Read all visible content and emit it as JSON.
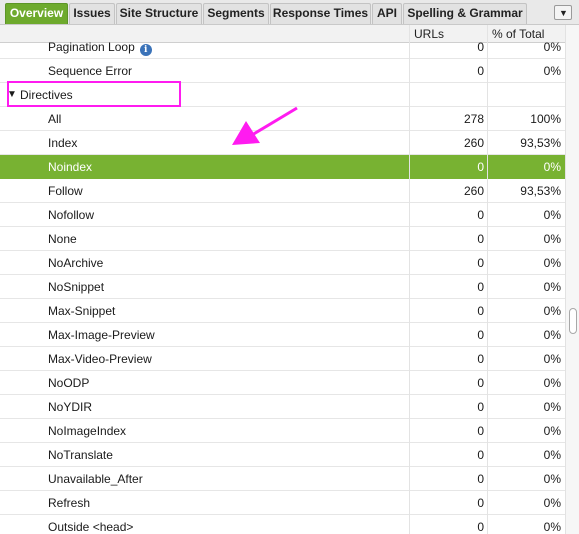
{
  "tabs": [
    {
      "label": "Overview",
      "active": true
    },
    {
      "label": "Issues",
      "active": false
    },
    {
      "label": "Site Structure",
      "active": false
    },
    {
      "label": "Segments",
      "active": false
    },
    {
      "label": "Response Times",
      "active": false
    },
    {
      "label": "API",
      "active": false
    },
    {
      "label": "Spelling & Grammar",
      "active": false
    }
  ],
  "tab_menu_icon": "chevron-down-icon",
  "columns": {
    "urls": "URLs",
    "pct": "% of Total"
  },
  "rows": [
    {
      "name": "Pagination Loop",
      "urls": "0",
      "pct": "0%",
      "info": "i"
    },
    {
      "name": "Sequence Error",
      "urls": "0",
      "pct": "0%"
    },
    {
      "name": "Directives",
      "urls": "",
      "pct": "",
      "group": true,
      "expanded_icon": "▼"
    },
    {
      "name": "All",
      "urls": "278",
      "pct": "100%"
    },
    {
      "name": "Index",
      "urls": "260",
      "pct": "93,53%"
    },
    {
      "name": "Noindex",
      "urls": "0",
      "pct": "0%",
      "selected": true
    },
    {
      "name": "Follow",
      "urls": "260",
      "pct": "93,53%"
    },
    {
      "name": "Nofollow",
      "urls": "0",
      "pct": "0%"
    },
    {
      "name": "None",
      "urls": "0",
      "pct": "0%"
    },
    {
      "name": "NoArchive",
      "urls": "0",
      "pct": "0%"
    },
    {
      "name": "NoSnippet",
      "urls": "0",
      "pct": "0%"
    },
    {
      "name": "Max-Snippet",
      "urls": "0",
      "pct": "0%"
    },
    {
      "name": "Max-Image-Preview",
      "urls": "0",
      "pct": "0%"
    },
    {
      "name": "Max-Video-Preview",
      "urls": "0",
      "pct": "0%"
    },
    {
      "name": "NoODP",
      "urls": "0",
      "pct": "0%"
    },
    {
      "name": "NoYDIR",
      "urls": "0",
      "pct": "0%"
    },
    {
      "name": "NoImageIndex",
      "urls": "0",
      "pct": "0%"
    },
    {
      "name": "NoTranslate",
      "urls": "0",
      "pct": "0%"
    },
    {
      "name": "Unavailable_After",
      "urls": "0",
      "pct": "0%"
    },
    {
      "name": "Refresh",
      "urls": "0",
      "pct": "0%"
    },
    {
      "name": "Outside <head>",
      "urls": "0",
      "pct": "0%"
    }
  ],
  "colors": {
    "active_tab": "#6eaa2d",
    "selected_row": "#78b232",
    "annotation": "#ff1bf0",
    "info_icon": "#3b73b9"
  }
}
